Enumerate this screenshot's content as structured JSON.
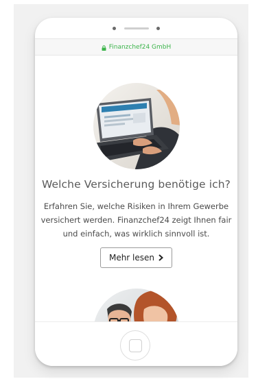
{
  "browser": {
    "url_text": "Finanzchef24 GmbH",
    "lock_icon": "lock-icon"
  },
  "content": {
    "headline": "Welche Versicherung benötige ich?",
    "body": "Erfahren Sie, welche Risiken in Ihrem Gewerbe versichert werden. Finanzchef24 zeigt Ihnen fair und einfach, was wirklich sinnvoll ist.",
    "cta_label": "Mehr lesen",
    "cta_icon": "chevron-right-icon"
  },
  "colors": {
    "secure_green": "#3cb44b",
    "headline": "#5a5a5a",
    "body": "#4a4a4a"
  }
}
